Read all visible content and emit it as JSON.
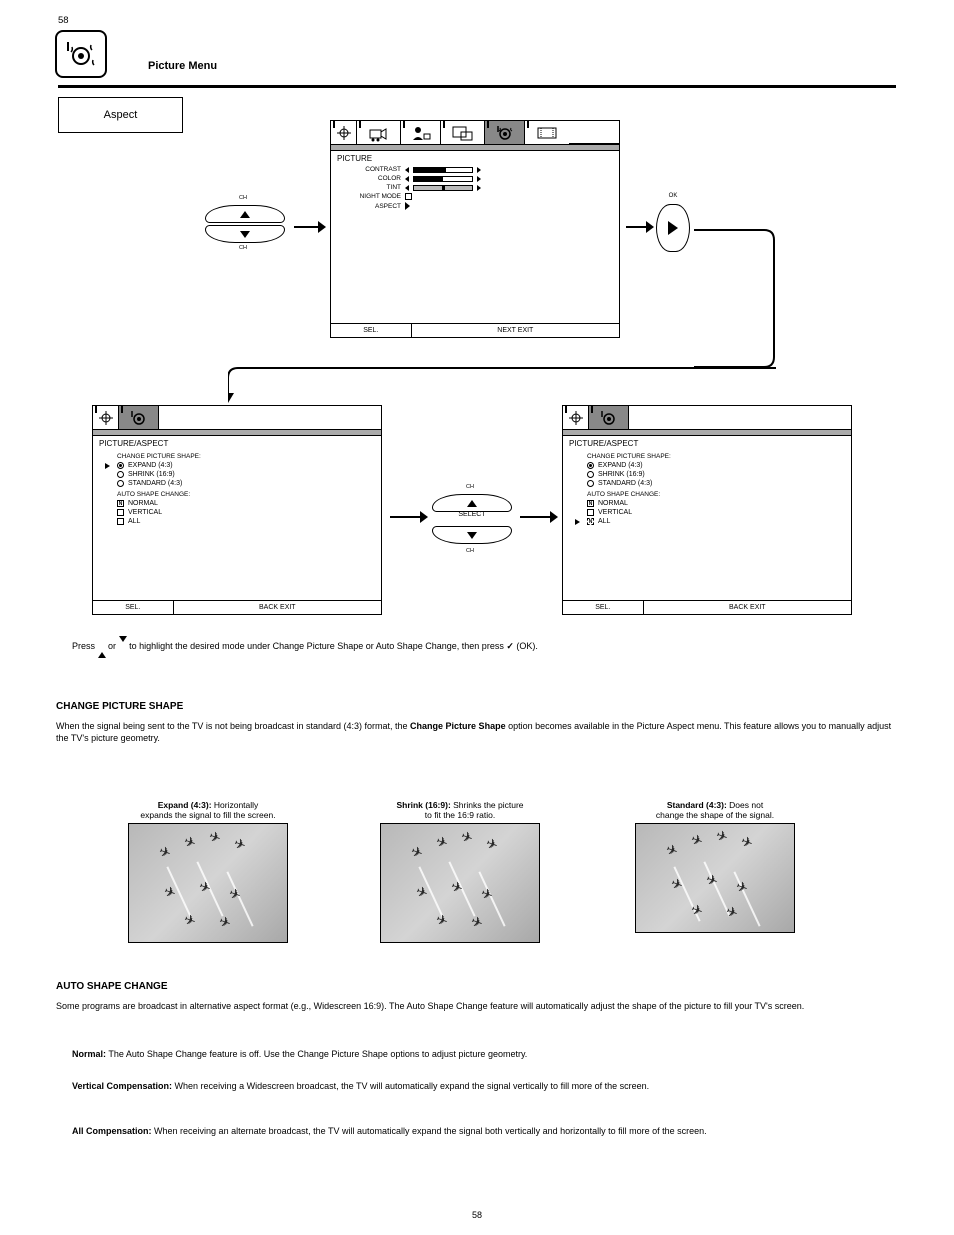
{
  "page": {
    "top_num": "58",
    "bottom_num": "58"
  },
  "section": {
    "title": "Picture Menu",
    "sub_box": "Aspect"
  },
  "screen1": {
    "title": "PICTURE",
    "rows": {
      "contrast": "CONTRAST",
      "color": "COLOR",
      "tint": "TINT",
      "night": "NIGHT MODE",
      "aspect": "ASPECT"
    },
    "foot_left": "SEL.",
    "foot_right": "NEXT        EXIT"
  },
  "screen2": {
    "breadcrumb": "PICTURE/ASPECT",
    "group1": "CHANGE PICTURE SHAPE:",
    "opt_expand": "EXPAND (4:3)",
    "opt_shrink": "SHRINK (16:9)",
    "opt_standard": "STANDARD (4:3)",
    "group2": "AUTO SHAPE CHANGE:",
    "opt_normal": "NORMAL",
    "opt_vertical": "VERTICAL",
    "opt_all": "ALL",
    "foot_left": "SEL.",
    "foot_right": "BACK        EXIT"
  },
  "controls": {
    "ch": "CH",
    "select": "SELECT",
    "ok": "OK"
  },
  "instructions": {
    "line1_a": "Press ",
    "line1_b": " or ",
    "line1_c": " to highlight the desired mode under Change Picture Shape or Auto Shape Change, then press ",
    "line1_d": "(OK)."
  },
  "shape_section": {
    "title": "CHANGE PICTURE SHAPE",
    "desc_a": "When the signal being sent to the TV is not being broadcast in standard (4:3) format, the ",
    "desc_b": "Change Picture Shape ",
    "desc_c": "option becomes available in the Picture Aspect menu. This feature allows you to manually adjust the TV's picture geometry.",
    "cap_expand_a": "Expand (4:3):",
    "cap_expand_b": " Horizontally",
    "cap_expand_c": "expands the signal to fill the screen.",
    "cap_shrink_a": "Shrink (16:9):",
    "cap_shrink_b": " Shrinks the picture",
    "cap_shrink_c": "to fit the 16:9 ratio.",
    "cap_standard_a": "Standard (4:3):",
    "cap_standard_b": " Does not",
    "cap_standard_c": "change the shape of the signal."
  },
  "auto_section": {
    "title": "AUTO SHAPE CHANGE",
    "p1": "Some programs are broadcast in alternative aspect format (e.g., Widescreen 16:9). The Auto Shape Change feature will automatically adjust the shape of the picture to fill your TV's screen.",
    "normal_a": "Normal:",
    "normal_b": " The Auto Shape Change feature is off. Use the Change Picture Shape options to adjust picture geometry.",
    "vertical_a": "Vertical Compensation:",
    "vertical_b": " When receiving a Widescreen broadcast, the TV will automatically expand the signal vertically to fill more of the screen.",
    "all_a": "All Compensation:",
    "all_b": " When receiving an alternate broadcast, the TV will automatically expand the signal both vertically and horizontally to fill more of the screen."
  }
}
